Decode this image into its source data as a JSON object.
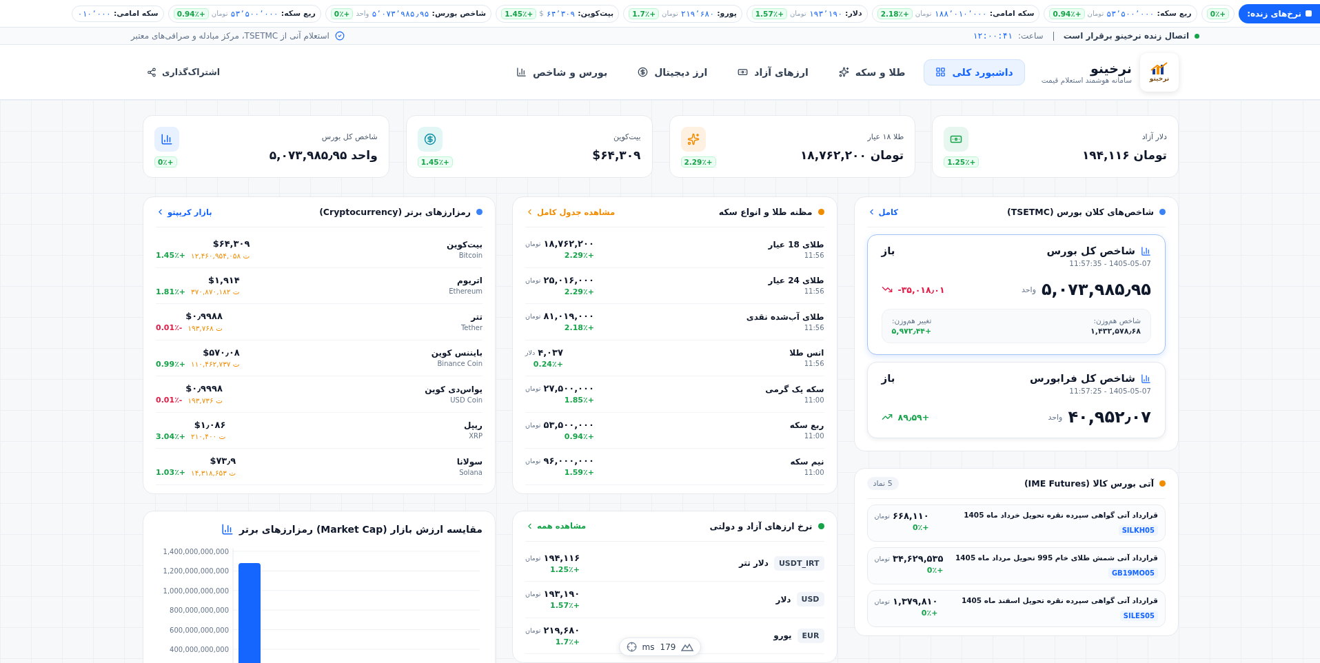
{
  "ticker": {
    "label": "نرخ‌های زنده:",
    "items": [
      {
        "change": "0٪+"
      },
      {
        "label": "ربع سکه:",
        "value": "۵۳٬۵۰۰٬۰۰۰",
        "unit": "تومان",
        "change": "0.94٪+"
      },
      {
        "label": "سکه امامی:",
        "value": "۱۸۸٬۰۱۰٬۰۰۰",
        "unit": "تومان",
        "change": "2.18٪+"
      },
      {
        "label": "دلار:",
        "value": "۱۹۳٬۱۹۰",
        "unit": "تومان",
        "change": "1.57٪+"
      },
      {
        "label": "یورو:",
        "value": "۲۱۹٬۶۸۰",
        "unit": "تومان",
        "change": "1.7٪+"
      },
      {
        "label": "بیت‌کوین:",
        "value": "۶۴٬۳۰۹",
        "unit": "$",
        "change": "1.45٪+"
      },
      {
        "label": "شاخص بورس:",
        "value": "۵٬۰۷۳٬۹۸۵٫۹۵",
        "unit": "واحد",
        "change": "0٪+"
      },
      {
        "label": "ربع سکه:",
        "value": "۵۳٬۵۰۰٬۰۰۰",
        "unit": "تومان",
        "change": "0.94٪+"
      },
      {
        "label": "سکه امامی:",
        "value": "۰۱۰٬۰۰۰"
      }
    ]
  },
  "status": {
    "connection": "اتصال زنده نرخینو برقرار است",
    "time_label": "ساعت:",
    "time": "۱۲:۰۰:۴۱",
    "source": "استعلام آنی از TSETMC، مرکز مبادله و صرافی‌های معتبر"
  },
  "header": {
    "brand": {
      "logo_text": "نرخینو",
      "name": "نرخینو",
      "tagline": "سامانه هوشمند استعلام قیمت"
    },
    "nav": [
      {
        "label": "داشبورد کلی",
        "kind": "dashboard",
        "selected": true
      },
      {
        "label": "طلا و سکه",
        "kind": "gold",
        "selected": false
      },
      {
        "label": "ارزهای آزاد",
        "kind": "cash",
        "selected": false
      },
      {
        "label": "ارز دیجیتال",
        "kind": "crypto",
        "selected": false
      },
      {
        "label": "بورس و شاخص",
        "kind": "index",
        "selected": false
      }
    ],
    "share": "اشتراک‌گذاری"
  },
  "stats": [
    {
      "kind": "cash",
      "label": "دلار آزاد",
      "value": "۱۹۴,۱۱۶ تومان",
      "change": "1.25٪+"
    },
    {
      "kind": "gold",
      "label": "طلا ۱۸ عیار",
      "value": "۱۸,۷۶۲,۲۰۰ تومان",
      "change": "2.29٪+"
    },
    {
      "kind": "crypto",
      "label": "بیت‌کوین",
      "value": "$۶۴,۳۰۹",
      "change": "1.45٪+"
    },
    {
      "kind": "index",
      "label": "شاخص کل بورس",
      "value": "۵,۰۷۳,۹۸۵٫۹۵ واحد",
      "change": "0٪+"
    }
  ],
  "bourse": {
    "title": "شاخص‌های کلان بورس (TSETMC)",
    "link": "کامل",
    "cards": [
      {
        "name": "شاخص کل بورس",
        "timestamp": "11:57:35 - 1405-05-07",
        "status": "باز",
        "value": "۵,۰۷۳,۹۸۵٫۹۵",
        "unit": "واحد",
        "change": "-۳۵,۰۱۸٫۰۱",
        "negative": true,
        "selected": true,
        "details": [
          {
            "label": "شاخص هم‌وزن:",
            "value": "۱,۴۳۲,۵۷۸٫۶۸"
          },
          {
            "label": "تغییر هم‌وزن:",
            "value": "۵,۹۷۲٫۴۴+",
            "negative": false
          }
        ]
      },
      {
        "name": "شاخص کل فرابورس",
        "timestamp": "11:57:25 - 1405-05-07",
        "status": "باز",
        "value": "۴۰,۹۵۲٫۰۷",
        "unit": "واحد",
        "change": "۸۹٫۵۹+",
        "negative": false,
        "selected": false
      }
    ]
  },
  "futures": {
    "title": "آتی بورس کالا (IME Futures)",
    "count": "5 نماد",
    "rows": [
      {
        "name": "قرارداد آتی گواهی سپرده نقره تحویل خرداد ماه 1405",
        "code": "SILKH05",
        "price": "۶۶۸,۱۱۰",
        "unit": "تومان",
        "change": "0٪+"
      },
      {
        "name": "قرارداد آتی شمش طلای خام 995 تحویل مرداد ماه 1405",
        "code": "GB19MO05",
        "price": "۳۴,۶۲۹,۵۳۵",
        "unit": "تومان",
        "change": "0٪+"
      },
      {
        "name": "قرارداد آتی گواهی سپرده نقره تحویل اسفند ماه 1405",
        "code": "SILES05",
        "price": "۱,۳۷۹,۸۱۰",
        "unit": "تومان",
        "change": "0٪+"
      }
    ]
  },
  "gold": {
    "title": "مظنه طلا و انواع سکه",
    "link": "مشاهده جدول کامل",
    "rows": [
      {
        "name": "طلای 18 عیار",
        "time": "11:56",
        "price": "۱۸,۷۶۲,۲۰۰",
        "unit": "تومان",
        "change": "2.29٪+"
      },
      {
        "name": "طلای 24 عیار",
        "time": "11:56",
        "price": "۲۵,۰۱۶,۰۰۰",
        "unit": "تومان",
        "change": "2.29٪+"
      },
      {
        "name": "طلای آب‌شده نقدی",
        "time": "11:56",
        "price": "۸۱,۰۱۹,۰۰۰",
        "unit": "تومان",
        "change": "2.18٪+"
      },
      {
        "name": "انس طلا",
        "time": "11:56",
        "price": "۴,۰۳۷",
        "unit": "دلار",
        "change": "0.24٪+"
      },
      {
        "name": "سکه یک گرمی",
        "time": "11:00",
        "price": "۲۷,۵۰۰,۰۰۰",
        "unit": "تومان",
        "change": "1.85٪+"
      },
      {
        "name": "ربع سکه",
        "time": "11:00",
        "price": "۵۳,۵۰۰,۰۰۰",
        "unit": "تومان",
        "change": "0.94٪+"
      },
      {
        "name": "نیم سکه",
        "time": "11:00",
        "price": "۹۶,۰۰۰,۰۰۰",
        "unit": "تومان",
        "change": "1.59٪+"
      }
    ]
  },
  "currencies": {
    "title": "نرخ ارزهای آزاد و دولتی",
    "link": "مشاهده همه",
    "rows": [
      {
        "code": "USDT_IRT",
        "name": "دلار تتر",
        "price": "۱۹۴,۱۱۶",
        "unit": "تومان",
        "change": "1.25٪+"
      },
      {
        "code": "USD",
        "name": "دلار",
        "price": "۱۹۳,۱۹۰",
        "unit": "تومان",
        "change": "1.57٪+"
      },
      {
        "code": "EUR",
        "name": "یورو",
        "price": "۲۱۹,۶۸۰",
        "unit": "تومان",
        "change": "1.7٪+"
      }
    ]
  },
  "crypto": {
    "title": "رمزارزهای برتر (Cryptocurrency)",
    "link": "بازار کریپتو",
    "rows": [
      {
        "name": "بیت‌کوین",
        "symbol_name": "Bitcoin",
        "price": "$۶۴,۳۰۹",
        "toman": "۱۲,۴۶۰,۹۵۴,۰۵۸ ت",
        "change": "1.45٪+",
        "negative": false
      },
      {
        "name": "اتریوم",
        "symbol_name": "Ethereum",
        "price": "$۱,۹۱۴",
        "toman": "۳۷۰,۸۷۰,۱۸۲ ت",
        "change": "1.81٪+",
        "negative": false
      },
      {
        "name": "تتر",
        "symbol_name": "Tether",
        "price": "$۰٫۹۹۸۸",
        "toman": "۱۹۳,۷۶۸ ت",
        "change": "0.01٪-",
        "negative": true
      },
      {
        "name": "بایننس کوین",
        "symbol_name": "Binance Coin",
        "price": "$۵۷۰٫۰۸",
        "toman": "۱۱۰,۴۶۲,۷۳۷ ت",
        "change": "0.99٪+",
        "negative": false
      },
      {
        "name": "یواس‌دی کوین",
        "symbol_name": "USD Coin",
        "price": "$۰٫۹۹۹۸",
        "toman": "۱۹۳,۷۳۶ ت",
        "change": "0.01٪-",
        "negative": true
      },
      {
        "name": "ریپل",
        "symbol_name": "XRP",
        "price": "$۱٫۰۸۶",
        "toman": "۲۱۰,۴۰۰ ت",
        "change": "3.04٪+",
        "negative": false
      },
      {
        "name": "سولانا",
        "symbol_name": "Solana",
        "price": "$۷۳٫۹",
        "toman": "۱۴,۳۱۸,۶۵۳ ت",
        "change": "1.03٪+",
        "negative": false
      }
    ]
  },
  "market_cap": {
    "chart_data": {
      "type": "bar",
      "title": "مقایسه ارزش بازار (Market Cap) رمزارزهای برتر",
      "values": [
        1280000000000
      ],
      "ylim": [
        0,
        1400000000000
      ],
      "grid": true,
      "yticks": [
        {
          "value": 400000000000,
          "label": "400,000,000,000"
        },
        {
          "value": 600000000000,
          "label": "600,000,000,000"
        },
        {
          "value": 800000000000,
          "label": "800,000,000,000"
        },
        {
          "value": 1000000000000,
          "label": "1,000,000,000,000"
        },
        {
          "value": 1200000000000,
          "label": "1,200,000,000,000"
        },
        {
          "value": 1400000000000,
          "label": "1,400,000,000,000"
        }
      ]
    }
  },
  "dev_overlay": {
    "unit": "ms",
    "value": "179"
  }
}
